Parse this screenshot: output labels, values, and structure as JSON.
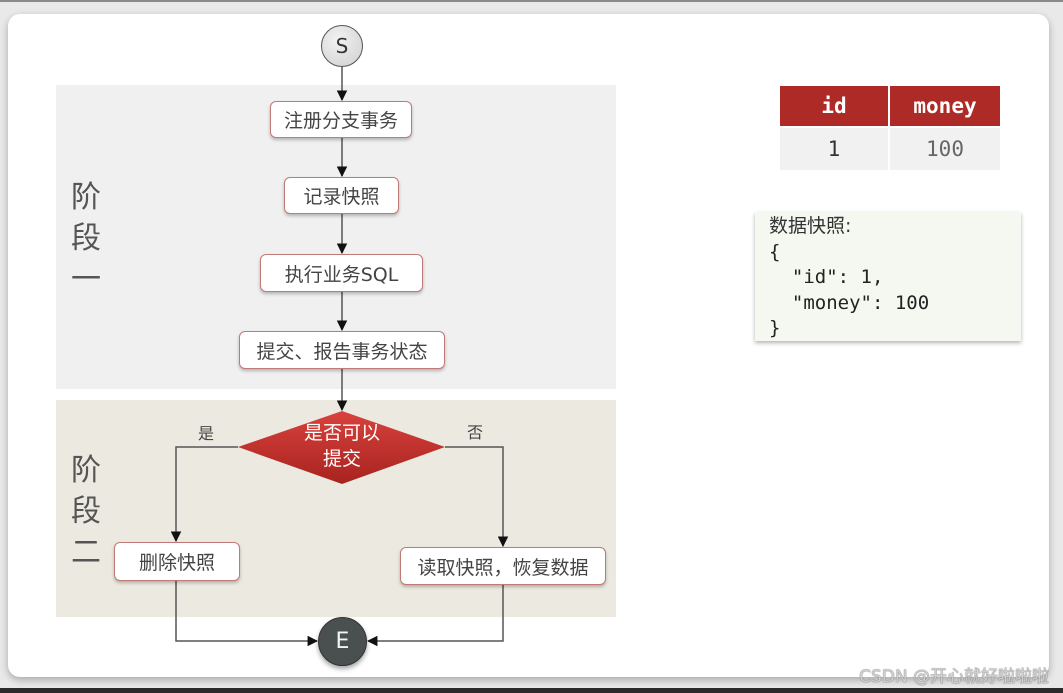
{
  "diagram": {
    "start_label": "S",
    "end_label": "E",
    "phases": [
      {
        "label": "阶\n段\n一"
      },
      {
        "label": "阶\n段\n二"
      }
    ],
    "nodes": {
      "register_branch": "注册分支事务",
      "record_snapshot": "记录快照",
      "execute_sql": "执行业务SQL",
      "commit_report": "提交、报告事务状态",
      "decision": "是否可以\n提交",
      "delete_snapshot": "删除快照",
      "restore_data": "读取快照，恢复数据"
    },
    "branches": {
      "yes": "是",
      "no": "否"
    }
  },
  "table": {
    "headers": [
      "id",
      "money"
    ],
    "rows": [
      [
        "1",
        "100"
      ]
    ]
  },
  "snapshot": {
    "title": "数据快照:",
    "body": "{\n  \"id\": 1,\n  \"money\": 100\n}"
  },
  "colors": {
    "accent_red": "#ae2a26",
    "node_border": "#c07a78",
    "phase_one_bg": "#f0f0f0",
    "phase_two_bg": "#eceae0"
  },
  "watermark": "CSDN @开心就好啦啦啦"
}
